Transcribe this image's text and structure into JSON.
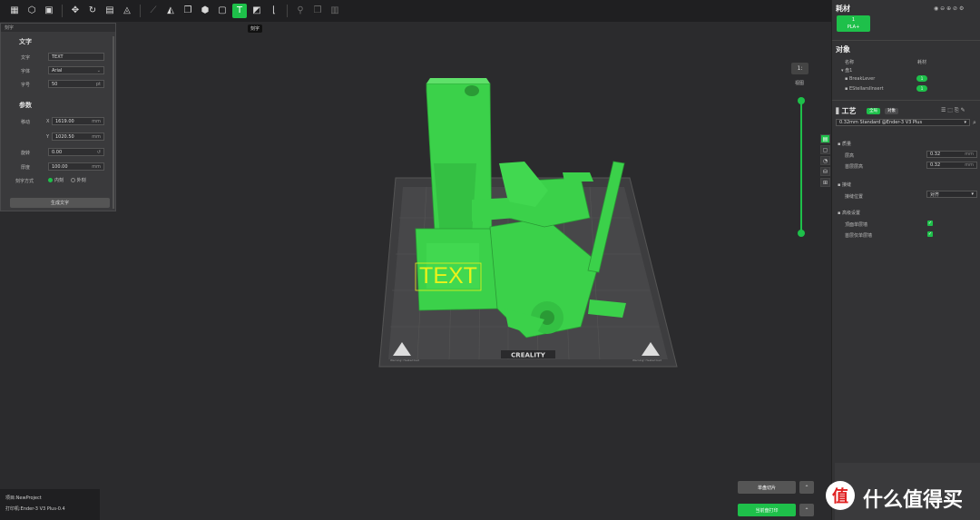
{
  "toolbar": {
    "buttons": [
      {
        "name": "open-file",
        "icon": "▦"
      },
      {
        "name": "add-model",
        "icon": "⬡"
      },
      {
        "name": "save",
        "icon": "▣"
      },
      {
        "name": "move",
        "icon": "✥"
      },
      {
        "name": "rotate",
        "icon": "↻"
      },
      {
        "name": "layout",
        "icon": "▤"
      },
      {
        "name": "cut",
        "icon": "◬"
      },
      {
        "name": "measure",
        "icon": "⟋"
      },
      {
        "name": "mirror",
        "icon": "◭"
      },
      {
        "name": "copy",
        "icon": "❐"
      },
      {
        "name": "hollow",
        "icon": "⬢"
      },
      {
        "name": "drill",
        "icon": "▢"
      },
      {
        "name": "text",
        "icon": "T"
      },
      {
        "name": "split",
        "icon": "◩"
      },
      {
        "name": "support",
        "icon": "⌊"
      },
      {
        "name": "paint",
        "icon": "⚲"
      },
      {
        "name": "arrange",
        "icon": "❒"
      },
      {
        "name": "grid",
        "icon": "▥"
      }
    ],
    "tooltip": "刻字"
  },
  "text_panel": {
    "title": "刻字",
    "section_text": "文字",
    "text_label": "文字",
    "text_value": "TEXT",
    "font_label": "字体",
    "font_value": "Arial",
    "size_label": "字号",
    "size_value": "50",
    "size_unit": "pt",
    "section_params": "参数",
    "move_label": "移动",
    "x_label": "X",
    "x_value": "1619.00",
    "y_label": "Y",
    "y_value": "1020.50",
    "unit_mm": "mm",
    "rotate_label": "旋转",
    "rotate_value": "0.00",
    "thickness_label": "厚度",
    "thickness_value": "100.00",
    "mode_label": "刻字方式",
    "mode_inner": "内刻",
    "mode_outer": "外刻",
    "generate_button": "生成文字"
  },
  "viewport": {
    "zoom_label": "1:",
    "view_label": "视图",
    "bed_brand": "CREALITY",
    "model_text": "TEXT",
    "bed_left_note": "Warning! Heated bed",
    "bed_right_note": "Warning! Heated bed"
  },
  "status": {
    "project": "项目:NewProject",
    "printer": "打印机:Ender-3 V3 Plus-0.4"
  },
  "slice": {
    "single_slice": "单盘切片",
    "multi_slice": "当前盘打印"
  },
  "right_panel": {
    "filament_title": "耗材",
    "filament_index": "1",
    "filament_name": "PLA+",
    "objects_title": "对象",
    "col_name": "名称",
    "col_filament": "耗材",
    "plate_name": "盘1",
    "objects": [
      {
        "name": "BreakLever",
        "filament": "1"
      },
      {
        "name": "EStellarsIlnsert",
        "filament": "1"
      }
    ],
    "process_title": "工艺",
    "tab_global": "全局",
    "tab_object": "对象",
    "profile": "0.32mm Standard @Ender-3 V3 Plus",
    "quality_section": "质量",
    "layer_height_label": "层高",
    "layer_height_value": "0.32",
    "first_layer_label": "首层层高",
    "first_layer_value": "0.32",
    "unit": "mm",
    "seam_section": "接缝",
    "seam_pos_label": "接缝位置",
    "seam_pos_value": "对齐",
    "advanced_section": "高级设置",
    "precise_wall_label": "顶面单层墙",
    "ironing_label": "首层仅单层墙"
  },
  "watermark": {
    "logo": "值",
    "text": "什么值得买"
  },
  "colors": {
    "accent": "#1ec04a",
    "model": "#3bd14a",
    "bed": "#3c3c3e"
  }
}
